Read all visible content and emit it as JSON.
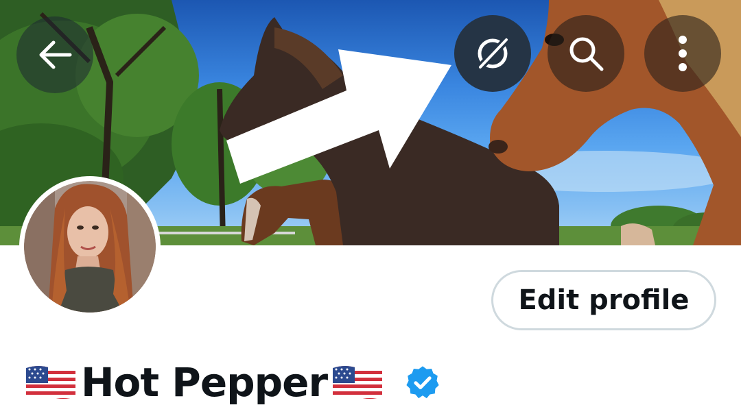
{
  "header": {
    "back_icon": "arrow-left-icon",
    "grok_icon": "grok-icon",
    "search_icon": "search-icon",
    "more_icon": "more-vertical-icon"
  },
  "banner": {
    "description_icon": "horses-banner-image"
  },
  "profile": {
    "edit_label": "Edit profile",
    "display_name": "Hot Pepper",
    "flag_icon": "us-flag-emoji",
    "verified_icon": "verified-badge-icon",
    "verified_color": "#1d9bf0"
  },
  "colors": {
    "text": "#0f1419",
    "border": "#cfd9de",
    "verified": "#1d9bf0"
  }
}
